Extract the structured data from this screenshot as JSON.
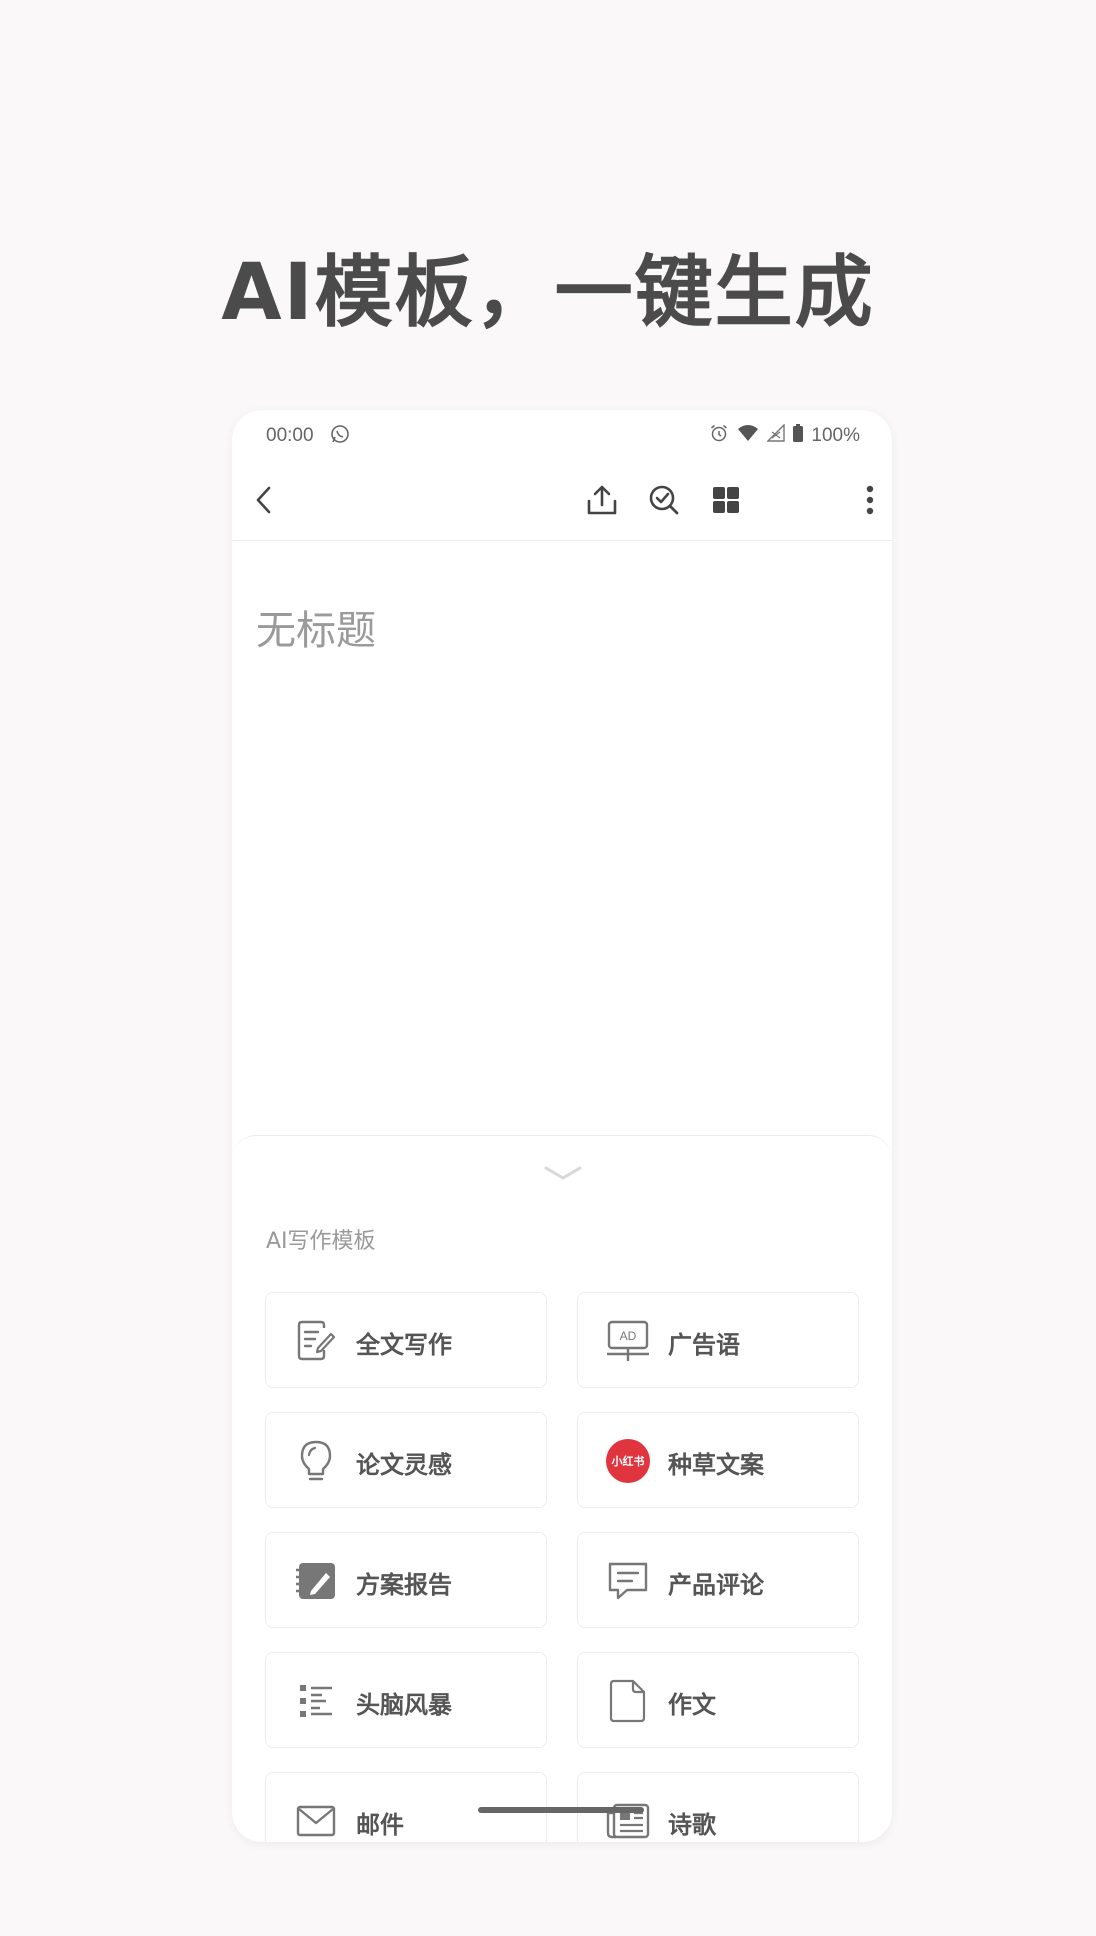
{
  "headline": "AI模板，一键生成",
  "status_bar": {
    "time": "00:00",
    "battery": "100%",
    "icons": [
      "whatsapp-icon",
      "alarm-icon",
      "wifi-icon",
      "signal-icon",
      "battery-icon"
    ]
  },
  "toolbar": {
    "icons": [
      "back-icon",
      "share-icon",
      "check-search-icon",
      "grid-icon",
      "more-icon"
    ]
  },
  "note": {
    "title_placeholder": "无标题"
  },
  "sheet": {
    "title": "AI写作模板",
    "templates": [
      {
        "label": "全文写作",
        "icon": "document-edit-icon"
      },
      {
        "label": "广告语",
        "icon": "ad-board-icon"
      },
      {
        "label": "论文灵感",
        "icon": "lightbulb-icon"
      },
      {
        "label": "种草文案",
        "icon": "xiaohongshu-icon",
        "icon_text": "小红书"
      },
      {
        "label": "方案报告",
        "icon": "notebook-pen-icon"
      },
      {
        "label": "产品评论",
        "icon": "comment-icon"
      },
      {
        "label": "头脑风暴",
        "icon": "list-icon"
      },
      {
        "label": "作文",
        "icon": "page-icon"
      },
      {
        "label": "邮件",
        "icon": "mail-icon"
      },
      {
        "label": "诗歌",
        "icon": "newspaper-icon"
      }
    ]
  },
  "colors": {
    "accent_red": "#e0343f",
    "text_dark": "#555555"
  }
}
